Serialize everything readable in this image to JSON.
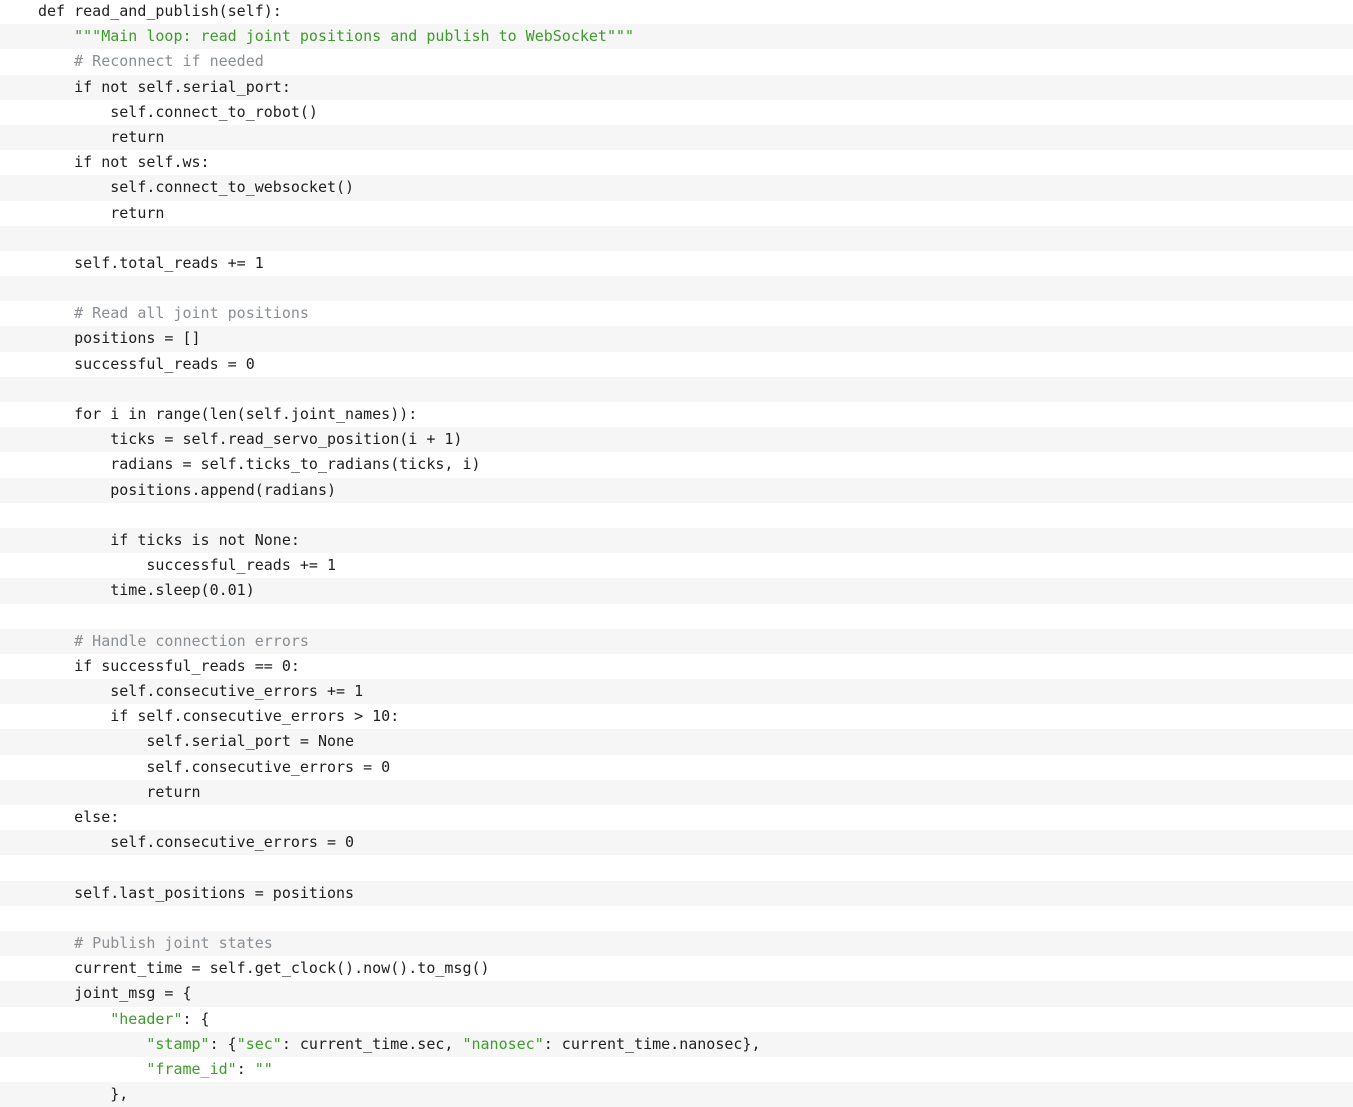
{
  "colors": {
    "text": "#1f1f1f",
    "comment": "#8a8f94",
    "string": "#3e9b2c",
    "stripe": "#f6f6f6",
    "background": "#ffffff"
  },
  "code": {
    "language": "python",
    "lines": [
      "def read_and_publish(self):",
      "    \"\"\"Main loop: read joint positions and publish to WebSocket\"\"\"",
      "    # Reconnect if needed",
      "    if not self.serial_port:",
      "        self.connect_to_robot()",
      "        return",
      "    if not self.ws:",
      "        self.connect_to_websocket()",
      "        return",
      "",
      "    self.total_reads += 1",
      "",
      "    # Read all joint positions",
      "    positions = []",
      "    successful_reads = 0",
      "",
      "    for i in range(len(self.joint_names)):",
      "        ticks = self.read_servo_position(i + 1)",
      "        radians = self.ticks_to_radians(ticks, i)",
      "        positions.append(radians)",
      "",
      "        if ticks is not None:",
      "            successful_reads += 1",
      "        time.sleep(0.01)",
      "",
      "    # Handle connection errors",
      "    if successful_reads == 0:",
      "        self.consecutive_errors += 1",
      "        if self.consecutive_errors > 10:",
      "            self.serial_port = None",
      "            self.consecutive_errors = 0",
      "            return",
      "    else:",
      "        self.consecutive_errors = 0",
      "",
      "    self.last_positions = positions",
      "",
      "    # Publish joint states",
      "    current_time = self.get_clock().now().to_msg()",
      "    joint_msg = {",
      "        \"header\": {",
      "            \"stamp\": {\"sec\": current_time.sec, \"nanosec\": current_time.nanosec},",
      "            \"frame_id\": \"\"",
      "        },"
    ]
  }
}
